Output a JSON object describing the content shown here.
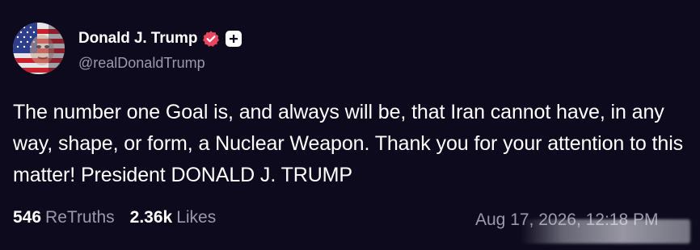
{
  "account": {
    "display_name": "Donald J. Trump",
    "handle": "@realDonaldTrump"
  },
  "post": {
    "text": "The number one Goal is, and always will be, that Iran cannot have, in any way, shape, or form, a Nuclear Weapon. Thank you for your attention to this matter! President DONALD J. TRUMP",
    "retruths_count": "546",
    "retruths_label": "ReTruths",
    "likes_count": "2.36k",
    "likes_label": "Likes",
    "timestamp": "Aug 17, 2026, 12:18 PM"
  },
  "icons": {
    "avatar": "avatar-american-flag-portrait",
    "verified": "verified-badge-icon",
    "add": "plus-icon"
  },
  "colors": {
    "background": "#0c0a1c",
    "text": "#ffffff",
    "muted": "#9c99ad",
    "verified": "#e8465e"
  }
}
